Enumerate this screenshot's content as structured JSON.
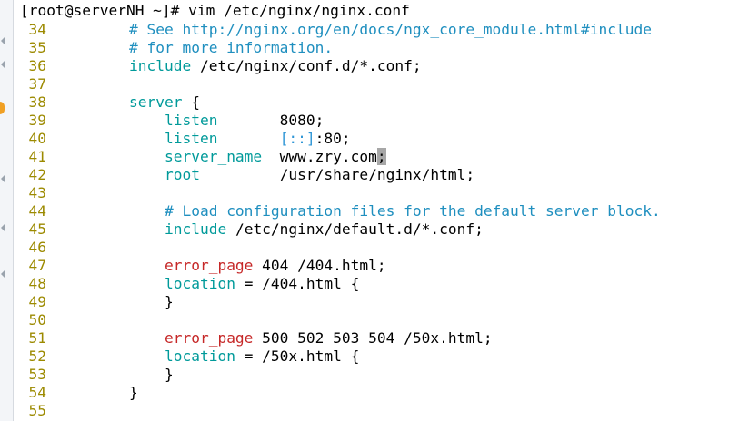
{
  "terminal": {
    "prompt": "[root@serverNH ~]# vim /etc/nginx/nginx.conf",
    "lines": [
      {
        "num": "34",
        "segments": [
          {
            "t": "    ",
            "c": "plain"
          },
          {
            "t": "# See http://nginx.org/en/docs/ngx_core_module.html#include",
            "c": "comment"
          }
        ]
      },
      {
        "num": "35",
        "segments": [
          {
            "t": "    ",
            "c": "plain"
          },
          {
            "t": "# for more information.",
            "c": "comment"
          }
        ]
      },
      {
        "num": "36",
        "segments": [
          {
            "t": "    ",
            "c": "plain"
          },
          {
            "t": "include",
            "c": "keyword"
          },
          {
            "t": " /etc/nginx/conf.d/*.conf;",
            "c": "plain"
          }
        ]
      },
      {
        "num": "37",
        "segments": []
      },
      {
        "num": "38",
        "segments": [
          {
            "t": "    ",
            "c": "plain"
          },
          {
            "t": "server",
            "c": "keyword"
          },
          {
            "t": " {",
            "c": "plain"
          }
        ]
      },
      {
        "num": "39",
        "segments": [
          {
            "t": "        ",
            "c": "plain"
          },
          {
            "t": "listen",
            "c": "keyword"
          },
          {
            "t": "       8080;",
            "c": "plain"
          }
        ]
      },
      {
        "num": "40",
        "segments": [
          {
            "t": "        ",
            "c": "plain"
          },
          {
            "t": "listen",
            "c": "keyword"
          },
          {
            "t": "       ",
            "c": "plain"
          },
          {
            "t": "[::]",
            "c": "blue"
          },
          {
            "t": ":80;",
            "c": "plain"
          }
        ]
      },
      {
        "num": "41",
        "segments": [
          {
            "t": "        ",
            "c": "plain"
          },
          {
            "t": "server_name",
            "c": "keyword"
          },
          {
            "t": "  www.zry.com",
            "c": "plain"
          },
          {
            "t": ";",
            "c": "cursor"
          }
        ]
      },
      {
        "num": "42",
        "segments": [
          {
            "t": "        ",
            "c": "plain"
          },
          {
            "t": "root",
            "c": "keyword"
          },
          {
            "t": "         /usr/share/nginx/html;",
            "c": "plain"
          }
        ]
      },
      {
        "num": "43",
        "segments": []
      },
      {
        "num": "44",
        "segments": [
          {
            "t": "        ",
            "c": "plain"
          },
          {
            "t": "# Load configuration files for the default server block.",
            "c": "comment"
          }
        ]
      },
      {
        "num": "45",
        "segments": [
          {
            "t": "        ",
            "c": "plain"
          },
          {
            "t": "include",
            "c": "keyword"
          },
          {
            "t": " /etc/nginx/default.d/*.conf;",
            "c": "plain"
          }
        ]
      },
      {
        "num": "46",
        "segments": []
      },
      {
        "num": "47",
        "segments": [
          {
            "t": "        ",
            "c": "plain"
          },
          {
            "t": "error_page",
            "c": "red"
          },
          {
            "t": " 404 /404.html;",
            "c": "plain"
          }
        ]
      },
      {
        "num": "48",
        "segments": [
          {
            "t": "        ",
            "c": "plain"
          },
          {
            "t": "location",
            "c": "keyword"
          },
          {
            "t": " = /404.html {",
            "c": "plain"
          }
        ]
      },
      {
        "num": "49",
        "segments": [
          {
            "t": "        }",
            "c": "plain"
          }
        ]
      },
      {
        "num": "50",
        "segments": []
      },
      {
        "num": "51",
        "segments": [
          {
            "t": "        ",
            "c": "plain"
          },
          {
            "t": "error_page",
            "c": "red"
          },
          {
            "t": " 500 502 503 504 /50x.html;",
            "c": "plain"
          }
        ]
      },
      {
        "num": "52",
        "segments": [
          {
            "t": "        ",
            "c": "plain"
          },
          {
            "t": "location",
            "c": "keyword"
          },
          {
            "t": " = /50x.html {",
            "c": "plain"
          }
        ]
      },
      {
        "num": "53",
        "segments": [
          {
            "t": "        }",
            "c": "plain"
          }
        ]
      },
      {
        "num": "54",
        "segments": [
          {
            "t": "    }",
            "c": "plain"
          }
        ]
      },
      {
        "num": "55",
        "segments": []
      }
    ]
  }
}
